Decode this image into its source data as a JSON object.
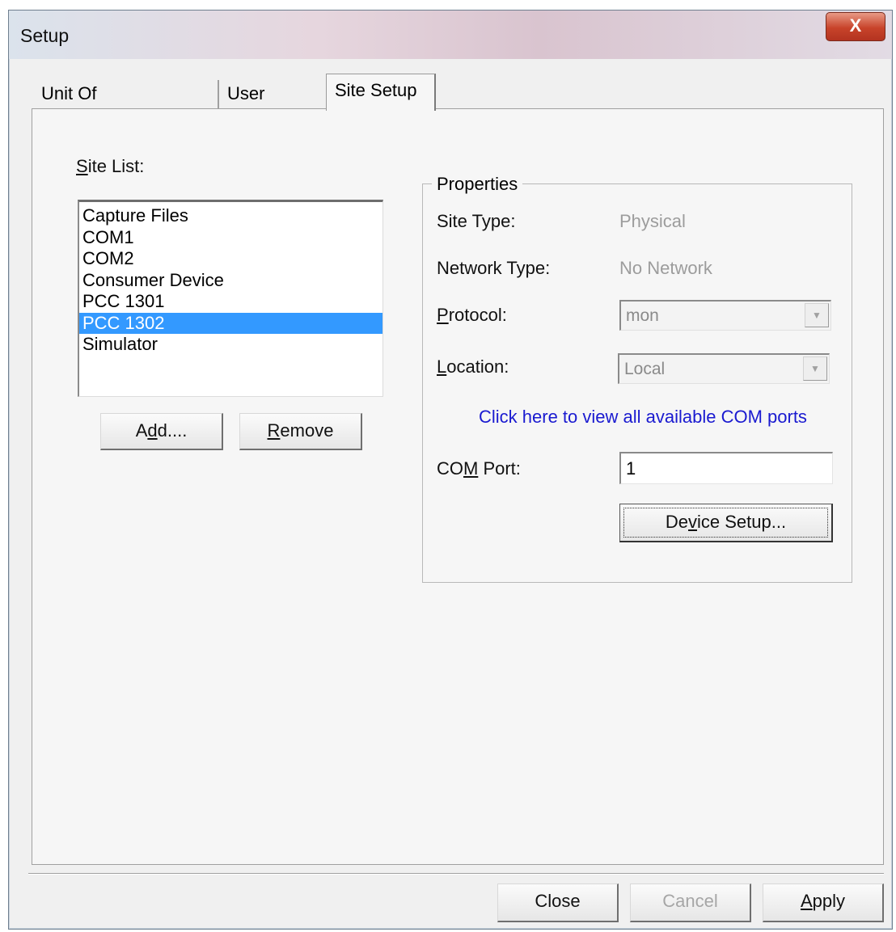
{
  "window": {
    "title": "Setup",
    "close_glyph": "X"
  },
  "tabs": [
    {
      "label": "Unit Of Measurement",
      "active": false
    },
    {
      "label": "User Setup",
      "active": false
    },
    {
      "label": "Site Setup",
      "active": true
    }
  ],
  "site_list": {
    "label_prefix": "S",
    "label_rest": "ite List:",
    "items": [
      "Capture Files",
      "COM1",
      "COM2",
      "Consumer Device",
      "PCC 1301",
      "PCC 1302",
      "Simulator"
    ],
    "selected": "PCC 1302"
  },
  "buttons": {
    "add": {
      "pre": "A",
      "under": "d",
      "post": "d...."
    },
    "remove": {
      "under": "R",
      "post": "emove"
    },
    "close": "Close",
    "cancel": "Cancel",
    "apply": {
      "under": "A",
      "post": "pply"
    },
    "device_setup": {
      "pre": "De",
      "under": "v",
      "post": "ice Setup..."
    }
  },
  "properties": {
    "group_title": "Properties",
    "site_type_label": "Site Type:",
    "site_type_value": "Physical",
    "network_type_label": "Network Type:",
    "network_type_value": "No Network",
    "protocol_label": {
      "under": "P",
      "post": "rotocol:"
    },
    "protocol_value": "mon",
    "location_label": {
      "under": "L",
      "post": "ocation:"
    },
    "location_value": "Local",
    "com_ports_link": "Click here to view all available COM ports",
    "com_port_label": {
      "pre": "CO",
      "under": "M",
      "post": " Port:"
    },
    "com_port_value": "1"
  },
  "colors": {
    "selection": "#3399ff",
    "link": "#1a1ad0",
    "close_button": "#c8432a"
  },
  "icons": {
    "close": "close-icon",
    "dropdown": "chevron-down-icon"
  }
}
